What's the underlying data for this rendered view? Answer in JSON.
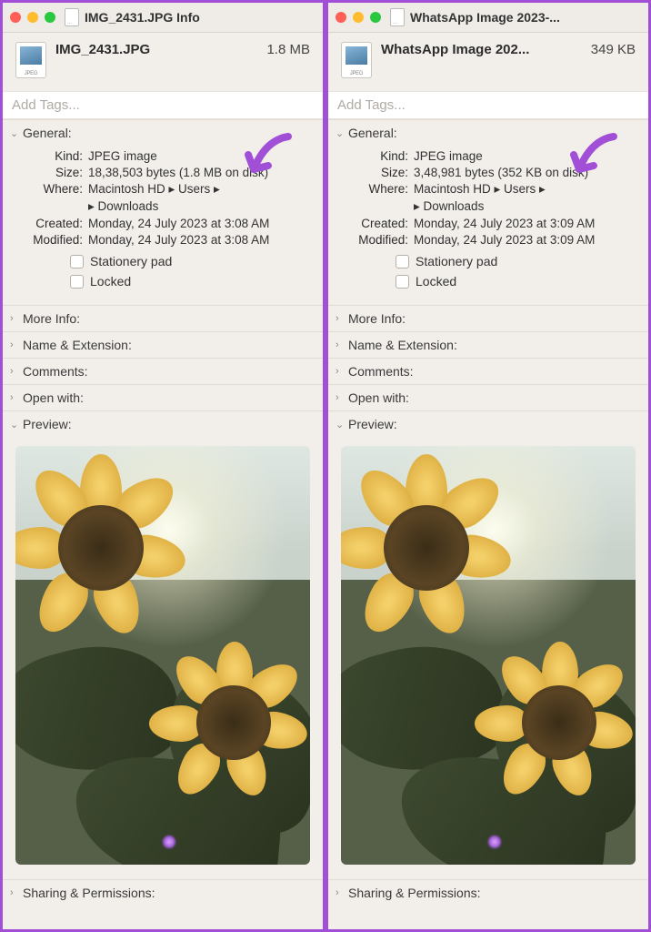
{
  "panes": [
    {
      "titlebar": "IMG_2431.JPG Info",
      "file_name": "IMG_2431.JPG",
      "file_size": "1.8 MB",
      "tags_placeholder": "Add Tags...",
      "sections": {
        "general_label": "General:",
        "more_info_label": "More Info:",
        "name_ext_label": "Name & Extension:",
        "comments_label": "Comments:",
        "open_with_label": "Open with:",
        "preview_label": "Preview:",
        "sharing_label": "Sharing & Permissions:"
      },
      "general": {
        "kind_label": "Kind:",
        "kind_value": "JPEG image",
        "size_label": "Size:",
        "size_value": "18,38,503 bytes (1.8 MB on disk)",
        "where_label": "Where:",
        "where_line1": "Macintosh HD ▸ Users ▸",
        "where_line2": "▸ Downloads",
        "created_label": "Created:",
        "created_value": "Monday, 24 July 2023 at 3:08 AM",
        "modified_label": "Modified:",
        "modified_value": "Monday, 24 July 2023 at 3:08 AM",
        "stationery_label": "Stationery pad",
        "locked_label": "Locked"
      }
    },
    {
      "titlebar": "WhatsApp Image 2023-...",
      "file_name": "WhatsApp Image 202...",
      "file_size": "349 KB",
      "tags_placeholder": "Add Tags...",
      "sections": {
        "general_label": "General:",
        "more_info_label": "More Info:",
        "name_ext_label": "Name & Extension:",
        "comments_label": "Comments:",
        "open_with_label": "Open with:",
        "preview_label": "Preview:",
        "sharing_label": "Sharing & Permissions:"
      },
      "general": {
        "kind_label": "Kind:",
        "kind_value": "JPEG image",
        "size_label": "Size:",
        "size_value": "3,48,981 bytes (352 KB on disk)",
        "where_label": "Where:",
        "where_line1": "Macintosh HD ▸ Users ▸",
        "where_line2": "▸ Downloads",
        "created_label": "Created:",
        "created_value": "Monday, 24 July 2023 at 3:09 AM",
        "modified_label": "Modified:",
        "modified_value": "Monday, 24 July 2023 at 3:09 AM",
        "stationery_label": "Stationery pad",
        "locked_label": "Locked"
      }
    }
  ]
}
